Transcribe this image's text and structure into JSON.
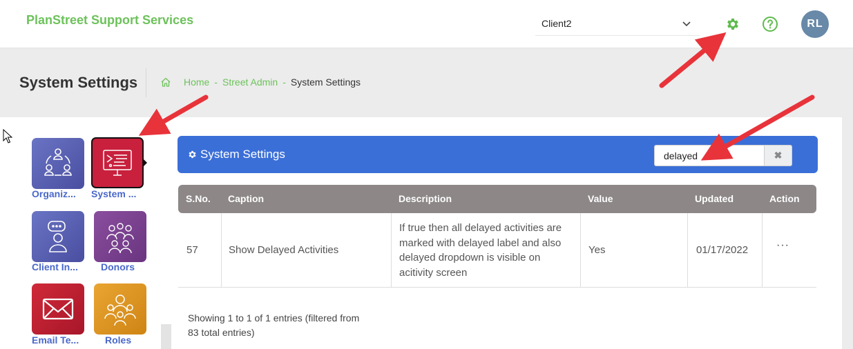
{
  "header": {
    "brand": "PlanStreet Support Services",
    "client_selected": "Client2",
    "user_initials": "RL"
  },
  "page": {
    "title": "System Settings",
    "breadcrumb": {
      "home": "Home",
      "sep": "-",
      "admin": "Street Admin",
      "current": "System Settings"
    }
  },
  "sidebar": {
    "tiles": [
      {
        "label": "Organiz...",
        "icon": "organization-icon"
      },
      {
        "label": "System ...",
        "icon": "system-settings-icon",
        "active": true
      },
      {
        "label": "Client In...",
        "icon": "client-info-icon"
      },
      {
        "label": "Donors",
        "icon": "donors-icon"
      },
      {
        "label": "Email Te...",
        "icon": "email-template-icon"
      },
      {
        "label": "Roles",
        "icon": "roles-icon"
      }
    ]
  },
  "panel": {
    "title": "System Settings",
    "search_value": "delayed"
  },
  "table": {
    "columns": [
      "S.No.",
      "Caption",
      "Description",
      "Value",
      "Updated",
      "Action"
    ],
    "rows": [
      {
        "sno": "57",
        "caption": "Show Delayed Activities",
        "description": "If true then all delayed activities are marked with delayed label and also delayed dropdown is visible on acitivity screen",
        "value": "Yes",
        "updated": "01/17/2022",
        "action": "···"
      }
    ]
  },
  "footer": {
    "info": "Showing 1 to 1 of 1 entries (filtered from 83 total entries)"
  },
  "colors": {
    "brand_green": "#6cc25a",
    "panel_blue": "#3b6fd8",
    "table_header": "#8d8787",
    "annotation_red": "#e8333a"
  }
}
